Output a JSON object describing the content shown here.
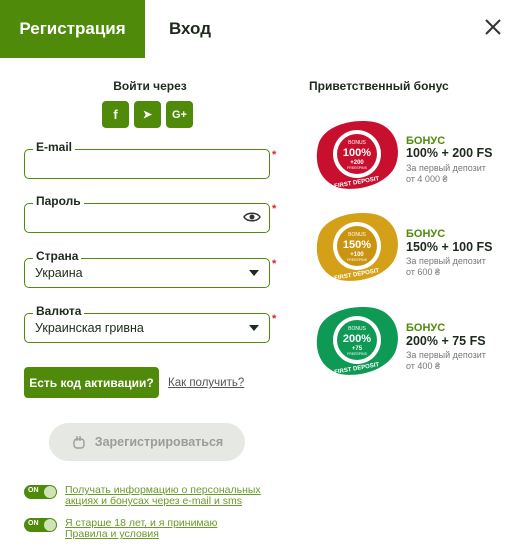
{
  "tabs": {
    "register": "Регистрация",
    "login": "Вход"
  },
  "social": {
    "title": "Войти через",
    "buttons": [
      {
        "icon": "facebook-icon",
        "glyph": "f"
      },
      {
        "icon": "telegram-icon",
        "glyph": "➤"
      },
      {
        "icon": "google-plus-icon",
        "glyph": "G+"
      }
    ]
  },
  "form": {
    "email_label": "E-mail",
    "password_label": "Пароль",
    "country_label": "Страна",
    "country_value": "Украина",
    "currency_label": "Валюта",
    "currency_value": "Украинская гривна",
    "required_mark": "*"
  },
  "activation": {
    "button": "Есть код активации?",
    "link": "Как получить?"
  },
  "register_button": "Зарегистрироваться",
  "consents": [
    {
      "toggle": "ON",
      "line1": "Получать информацию о персональных",
      "line2": "акциях и бонусах через e-mail и sms"
    },
    {
      "toggle": "ON",
      "line1": "Я старше 18 лет, и я принимаю",
      "line2": "Правила и условия"
    }
  ],
  "bonus": {
    "title": "Приветственный бонус",
    "items": [
      {
        "badge_top": "BONUS",
        "badge_pct": "100%",
        "badge_fs": "+200",
        "badge_fs_label": "FREESPINS",
        "ribbon": "FIRST DEPOSIT",
        "label": "БОНУС",
        "amount": "100% + 200 FS",
        "sub1": "За первый депозит",
        "sub2": "от 4 000 ₴",
        "color": "#c8102e"
      },
      {
        "badge_top": "BONUS",
        "badge_pct": "150%",
        "badge_fs": "+100",
        "badge_fs_label": "FREESPINS",
        "ribbon": "FIRST DEPOSIT",
        "label": "БОНУС",
        "amount": "150% + 100 FS",
        "sub1": "За первый депозит",
        "sub2": "от 600 ₴",
        "color": "#d4a017"
      },
      {
        "badge_top": "BONUS",
        "badge_pct": "200%",
        "badge_fs": "+75",
        "badge_fs_label": "FREESPINS",
        "ribbon": "FIRST DEPOSIT",
        "label": "БОНУС",
        "amount": "200% + 75 FS",
        "sub1": "За первый депозит",
        "sub2": "от 400 ₴",
        "color": "#0e9a55"
      }
    ]
  },
  "colors": {
    "accent": "#4f8a0b",
    "required": "#e0202a"
  }
}
